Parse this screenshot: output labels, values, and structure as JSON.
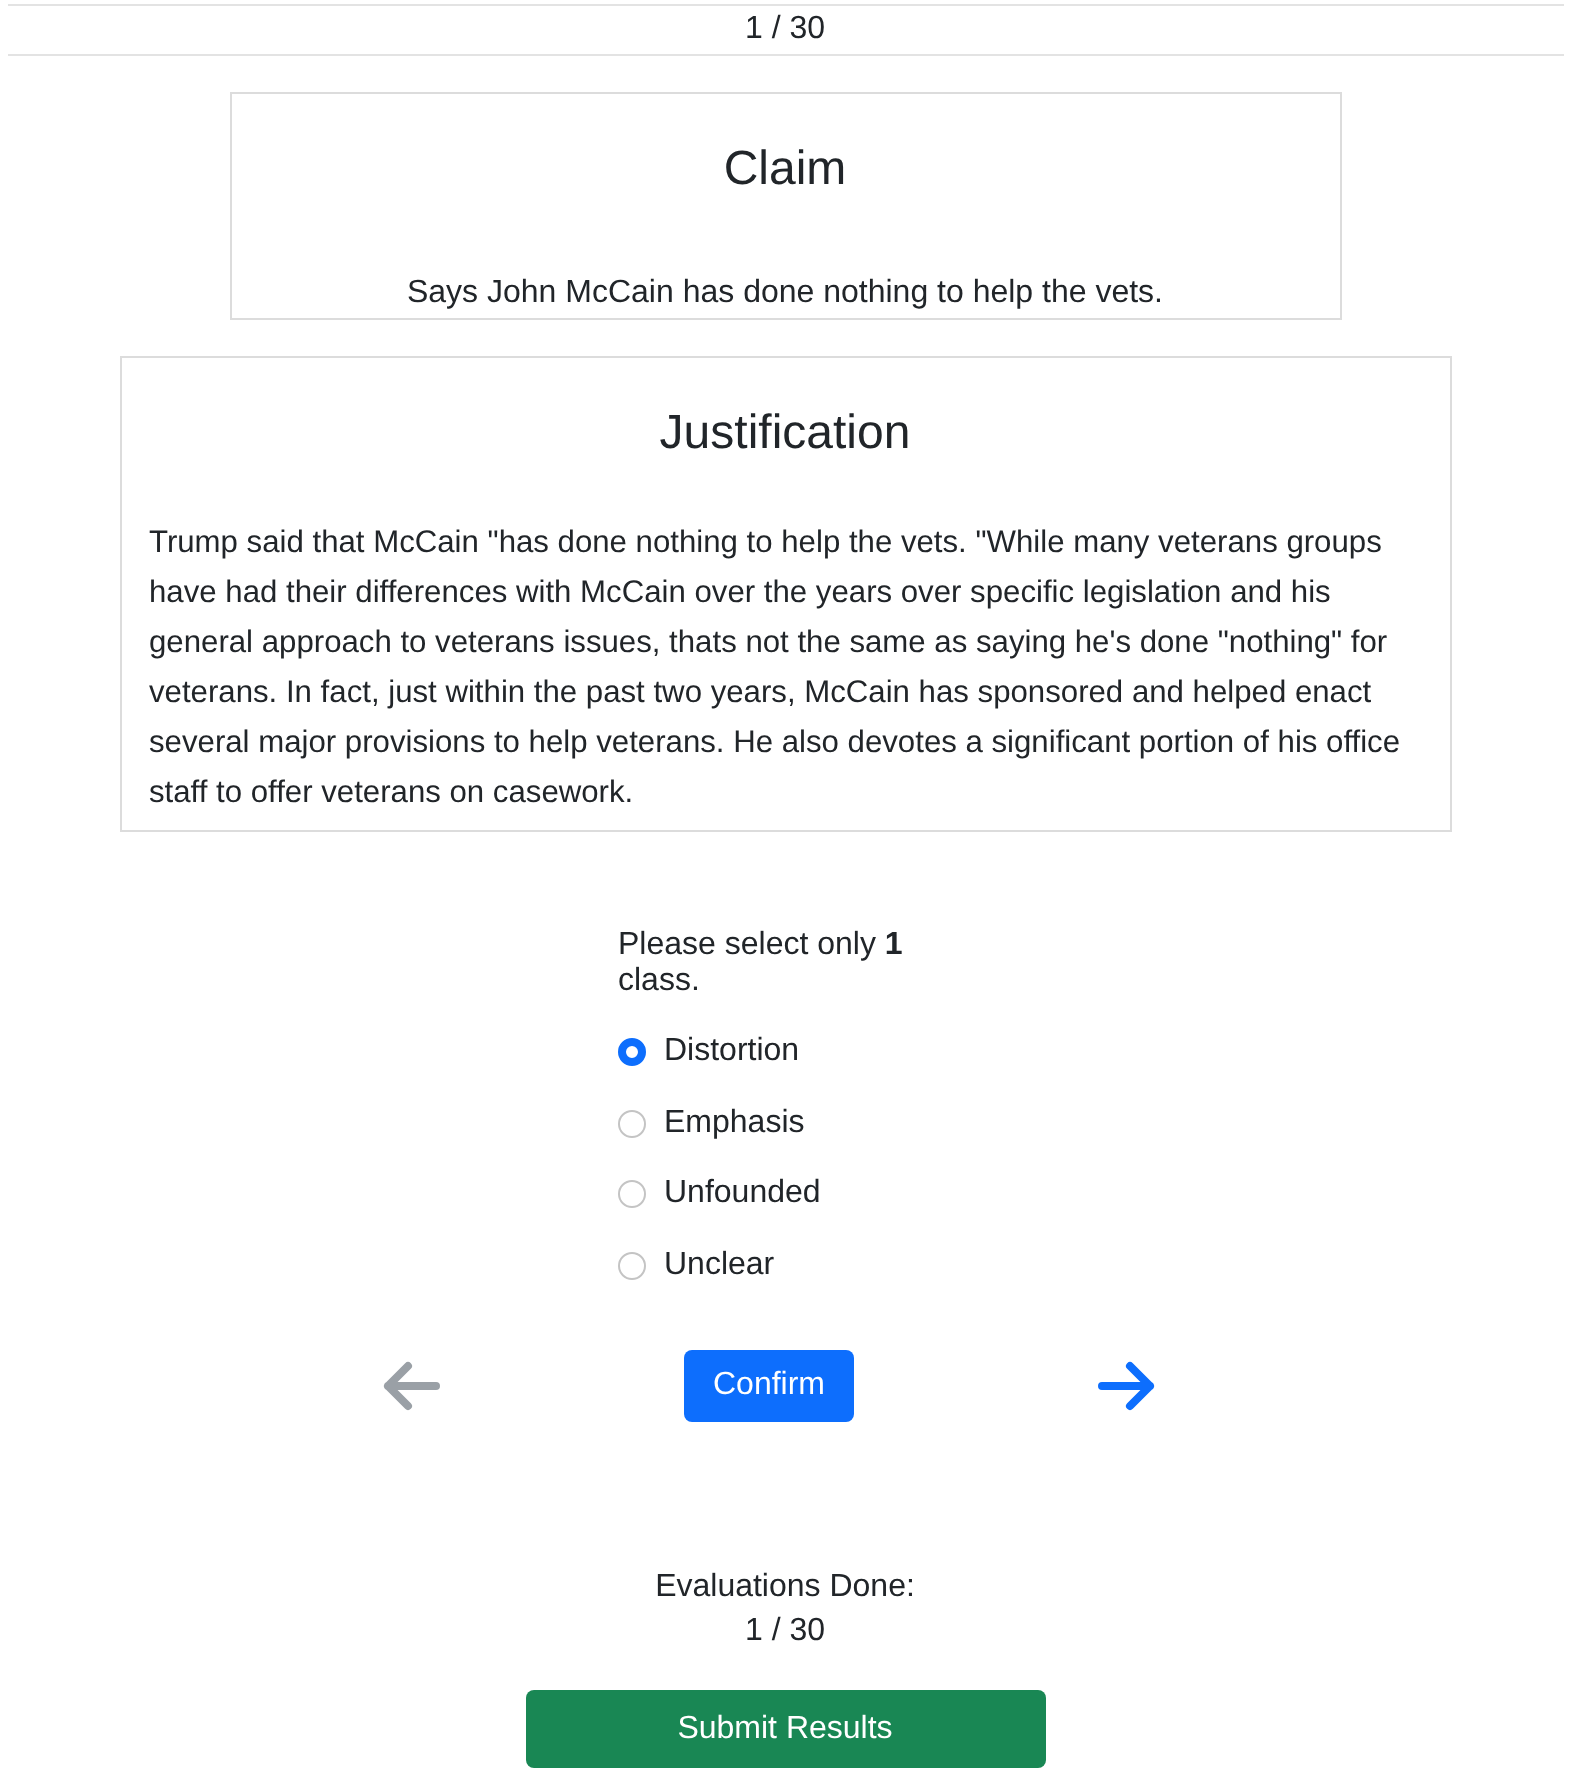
{
  "counter": "1 / 30",
  "claim": {
    "title": "Claim",
    "text": "Says John McCain has done nothing to help the vets."
  },
  "justification": {
    "title": "Justification",
    "text": "Trump said that McCain \"has done nothing to help the vets. \"While many veterans groups have had their differences with McCain over the years over specific legislation and his general approach to veterans issues, thats not the same as saying he's done \"nothing\" for veterans. In fact, just within the past two years, McCain has sponsored and helped enact several major provisions to help veterans. He also devotes a significant portion of his office staff to offer veterans on casework."
  },
  "prompt": "Please select only **1** class.",
  "options": [
    {
      "label": "Distortion",
      "selected": true
    },
    {
      "label": "Emphasis",
      "selected": false
    },
    {
      "label": "Unfounded",
      "selected": false
    },
    {
      "label": "Unclear",
      "selected": false
    }
  ],
  "nav": {
    "previous": {
      "disabled": true
    },
    "next": {
      "disabled": false
    }
  },
  "confirm_button": "Confirm",
  "evaluations": {
    "label": "Evaluations Done:",
    "count": "1 / 30"
  },
  "submit_button": "Submit Results"
}
